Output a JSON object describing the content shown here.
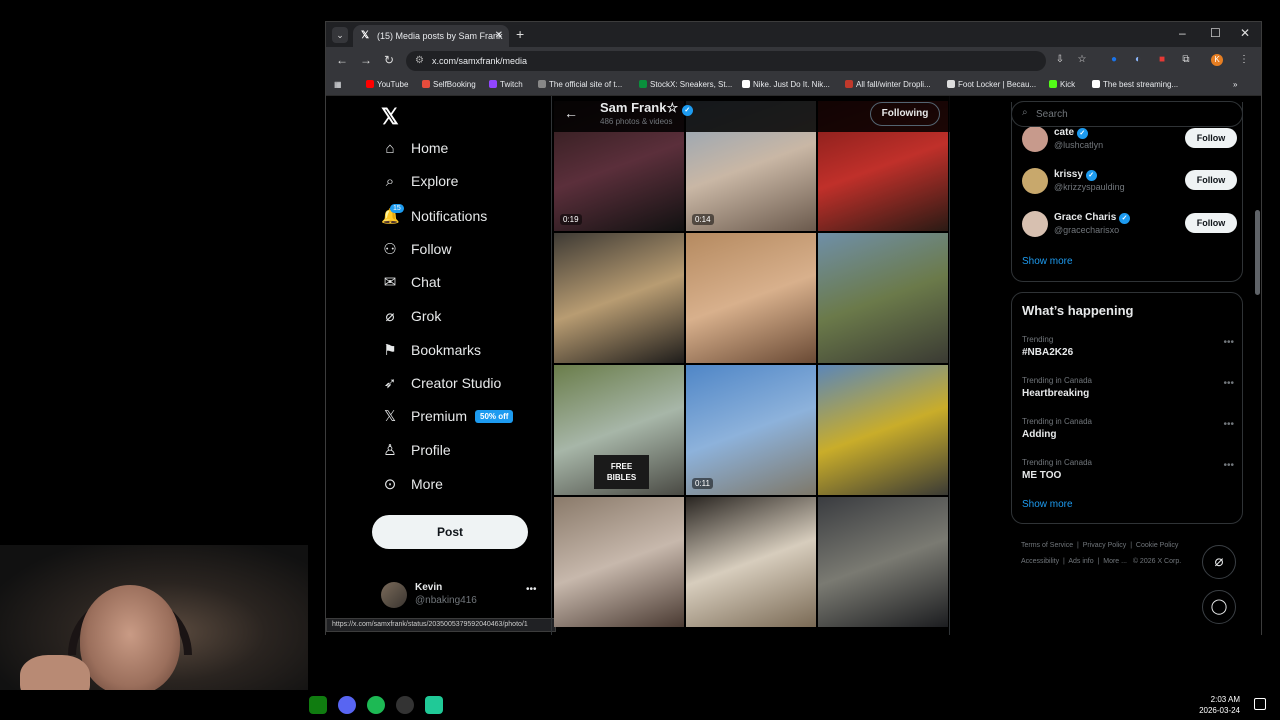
{
  "browser": {
    "tab_title": "(15) Media posts by Sam Frank",
    "url": "x.com/samxfrank/media",
    "bookmarks": [
      "YouTube",
      "SelfBooking",
      "Twitch",
      "The official site of t...",
      "StockX: Sneakers, St...",
      "Nike. Just Do It. Nik...",
      "All fall/winter Dropli...",
      "Foot Locker | Becau...",
      "Kick",
      "The best streaming..."
    ],
    "status_url": "https://x.com/samxfrank/status/2035005379592040463/photo/1"
  },
  "nav": {
    "items": [
      {
        "label": "Home",
        "icon": "home-icon"
      },
      {
        "label": "Explore",
        "icon": "search-icon"
      },
      {
        "label": "Notifications",
        "icon": "bell-icon",
        "badge": "15"
      },
      {
        "label": "Follow",
        "icon": "person-plus-icon"
      },
      {
        "label": "Chat",
        "icon": "mail-icon"
      },
      {
        "label": "Grok",
        "icon": "grok-icon"
      },
      {
        "label": "Bookmarks",
        "icon": "bookmark-icon"
      },
      {
        "label": "Creator Studio",
        "icon": "rocket-icon"
      },
      {
        "label": "Premium",
        "icon": "x-icon",
        "promo": "50% off"
      },
      {
        "label": "Profile",
        "icon": "person-icon"
      },
      {
        "label": "More",
        "icon": "more-circle-icon"
      }
    ],
    "post_label": "Post"
  },
  "account": {
    "name": "Kevin",
    "handle": "@nbaking416"
  },
  "profile": {
    "name": "Sam Frank☆",
    "count": "486 photos & videos",
    "following_label": "Following"
  },
  "media": [
    {
      "duration": "0:19",
      "colors": [
        "#2a1a1a",
        "#5b2f3b",
        "#111"
      ]
    },
    {
      "duration": "0:14",
      "colors": [
        "#8aa1b8",
        "#c9b7a5",
        "#6b5a4d"
      ]
    },
    {
      "duration": "",
      "colors": [
        "#7a1a18",
        "#c0302a",
        "#2a1a14"
      ]
    },
    {
      "duration": "",
      "colors": [
        "#3e3a34",
        "#b89c72",
        "#1f1d1b"
      ]
    },
    {
      "duration": "",
      "colors": [
        "#b58a60",
        "#d8b08c",
        "#6a4a35"
      ]
    },
    {
      "duration": "",
      "colors": [
        "#6f8fa8",
        "#6b7a4a",
        "#3a3a33"
      ]
    },
    {
      "duration": "",
      "colors": [
        "#6a7d4a",
        "#a7b6a8",
        "#4a4a44"
      ],
      "sign": "FREE BIBLES"
    },
    {
      "duration": "0:11",
      "colors": [
        "#4f86c7",
        "#8db2db",
        "#7e7869"
      ]
    },
    {
      "duration": "",
      "colors": [
        "#5b86b8",
        "#c9ad2a",
        "#3b3b35"
      ]
    },
    {
      "duration": "",
      "colors": [
        "#8a7a6a",
        "#c7b8ac",
        "#4a3a32"
      ]
    },
    {
      "duration": "",
      "colors": [
        "#2a2622",
        "#d7cdbd",
        "#7a6a55"
      ]
    },
    {
      "duration": "",
      "colors": [
        "#3a3c40",
        "#7a7a72",
        "#1c1d20"
      ]
    }
  ],
  "search": {
    "placeholder": "Search"
  },
  "suggestions": [
    {
      "name": "cate",
      "handle": "@lushcatlyn",
      "follow": "Follow",
      "color": "#c79a8c"
    },
    {
      "name": "krissy",
      "handle": "@krizzyspaulding",
      "follow": "Follow",
      "color": "#c8a86c"
    },
    {
      "name": "Grace Charis",
      "handle": "@gracecharisxo",
      "follow": "Follow",
      "color": "#d7c0b0"
    }
  ],
  "show_more": "Show more",
  "happening": {
    "title": "What’s happening",
    "trends": [
      {
        "context": "Trending",
        "topic": "#NBA2K26"
      },
      {
        "context": "Trending in Canada",
        "topic": "Heartbreaking"
      },
      {
        "context": "Trending in Canada",
        "topic": "Adding"
      },
      {
        "context": "Trending in Canada",
        "topic": "ME TOO"
      }
    ],
    "show_more": "Show more"
  },
  "footer": {
    "links": [
      "Terms of Service",
      "Privacy Policy",
      "Cookie Policy",
      "Accessibility",
      "Ads info",
      "More ...",
      "© 2026 X Corp."
    ]
  },
  "taskbar": {
    "time": "2:03 AM",
    "date": "2026-03-24"
  },
  "colors": {
    "accent": "#1d9bf0"
  }
}
